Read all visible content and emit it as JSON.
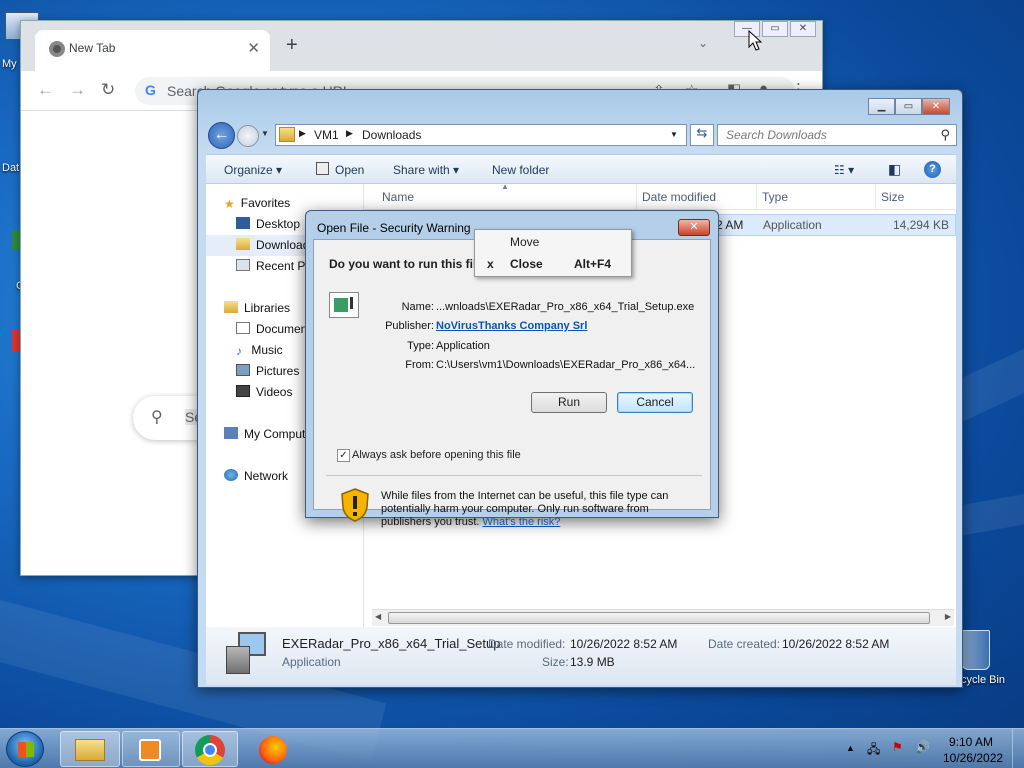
{
  "desktop": {
    "icons": [
      "My",
      "Dat",
      "C",
      "Recycle Bin"
    ]
  },
  "chrome": {
    "tab_title": "New Tab",
    "tab_close": "✕",
    "new_tab": "+",
    "omnibox_placeholder": "Search Google or type a URL",
    "search_text": "Se"
  },
  "explorer": {
    "breadcrumb": [
      "VM1",
      "Downloads"
    ],
    "search_placeholder": "Search Downloads",
    "commands": {
      "organize": "Organize ▾",
      "open": "Open",
      "share_with": "Share with ▾",
      "new_folder": "New folder"
    },
    "nav": {
      "favorites": "Favorites",
      "desktop": "Desktop",
      "downloads": "Downloads",
      "recent_places": "Recent Places",
      "libraries": "Libraries",
      "documents": "Documents",
      "music": "Music",
      "pictures": "Pictures",
      "videos": "Videos",
      "my_computer": "My Computer",
      "network": "Network"
    },
    "columns": {
      "name": "Name",
      "date_modified": "Date modified",
      "type": "Type",
      "size": "Size"
    },
    "row": {
      "date_fragment": "2 AM",
      "type": "Application",
      "size": "14,294 KB"
    },
    "details": {
      "filename": "EXERadar_Pro_x86_x64_Trial_Setup",
      "filetype": "Application",
      "date_modified_label": "Date modified:",
      "date_modified": "10/26/2022 8:52 AM",
      "date_created_label": "Date created:",
      "date_created": "10/26/2022 8:52 AM",
      "size_label": "Size:",
      "size": "13.9 MB"
    }
  },
  "dialog": {
    "title": "Open File - Security Warning",
    "question": "Do you want to run this fil",
    "name_label": "Name:",
    "name_value": "...wnloads\\EXERadar_Pro_x86_x64_Trial_Setup.exe",
    "publisher_label": "Publisher:",
    "publisher_value": "NoVirusThanks Company Srl",
    "type_label": "Type:",
    "type_value": "Application",
    "from_label": "From:",
    "from_value": "C:\\Users\\vm1\\Downloads\\EXERadar_Pro_x86_x64...",
    "run": "Run",
    "cancel": "Cancel",
    "checkbox_label": "Always ask before opening this file",
    "warning_text": "While files from the Internet can be useful, this file type can potentially harm your computer. Only run software from publishers you trust.",
    "risk_link": "What's the risk?"
  },
  "context_menu": {
    "move": "Move",
    "close_marker": "x",
    "close": "Close",
    "close_shortcut": "Alt+F4"
  },
  "taskbar": {
    "time": "9:10 AM",
    "date": "10/26/2022",
    "tray_arrow": "▲"
  }
}
